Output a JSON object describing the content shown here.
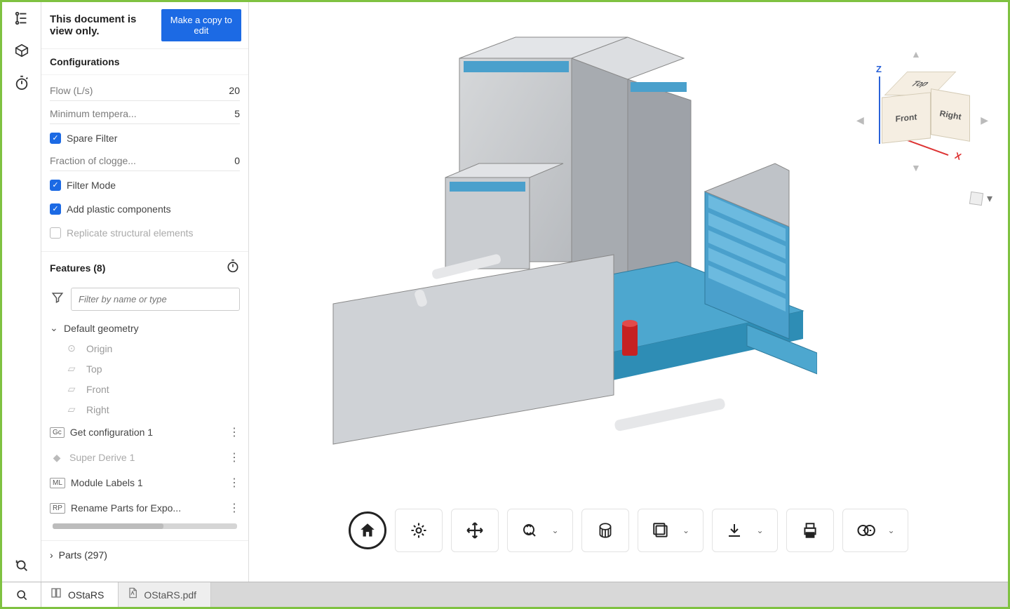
{
  "banner": {
    "text": "This document is view only.",
    "button": "Make a copy to edit"
  },
  "configurations": {
    "title": "Configurations",
    "params": [
      {
        "label": "Flow (L/s)",
        "value": "20"
      },
      {
        "label": "Minimum tempera...",
        "value": "5"
      }
    ],
    "spare_filter": {
      "label": "Spare Filter",
      "checked": true
    },
    "fraction": {
      "label": "Fraction of clogge...",
      "value": "0"
    },
    "filter_mode": {
      "label": "Filter Mode",
      "checked": true
    },
    "add_plastic": {
      "label": "Add plastic components",
      "checked": true
    },
    "replicate": {
      "label": "Replicate structural elements",
      "checked": false
    }
  },
  "features": {
    "title": "Features (8)",
    "filter_placeholder": "Filter by name or type",
    "default_geometry": {
      "label": "Default geometry",
      "items": [
        {
          "name": "Origin",
          "icon": "origin"
        },
        {
          "name": "Top",
          "icon": "plane"
        },
        {
          "name": "Front",
          "icon": "plane"
        },
        {
          "name": "Right",
          "icon": "plane"
        }
      ]
    },
    "list": [
      {
        "badge": "Gc",
        "name": "Get configuration 1",
        "disabled": false
      },
      {
        "badge": "◆",
        "name": "Super Derive 1",
        "disabled": true
      },
      {
        "badge": "ML",
        "name": "Module Labels 1",
        "disabled": false
      },
      {
        "badge": "RP",
        "name": "Rename Parts for Expo...",
        "disabled": false
      }
    ]
  },
  "parts": {
    "label": "Parts (297)"
  },
  "viewcube": {
    "top": "Top",
    "front": "Front",
    "right": "Right"
  },
  "tabs": [
    {
      "name": "OStaRS",
      "icon": "part",
      "active": true
    },
    {
      "name": "OStaRS.pdf",
      "icon": "pdf",
      "active": false
    }
  ]
}
